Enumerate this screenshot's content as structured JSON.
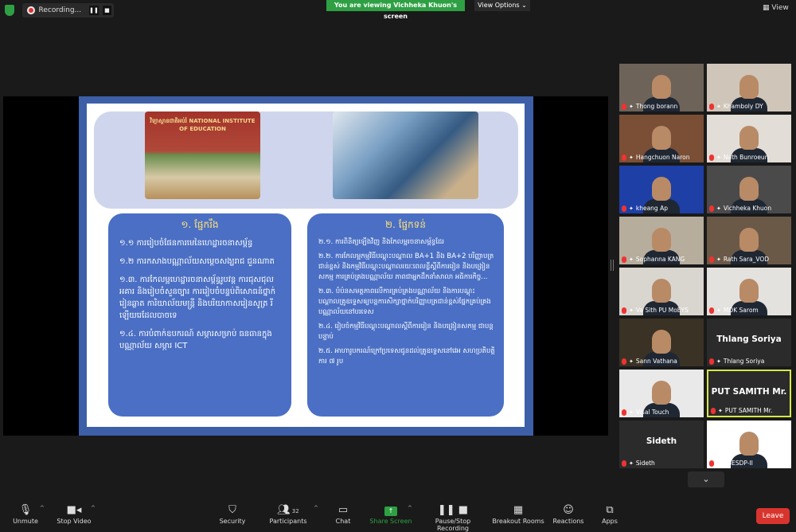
{
  "topbar": {
    "recording_label": "Recording...",
    "pause_glyph": "❚❚",
    "stop_glyph": "■",
    "viewing_banner": "You are viewing Vichheka Khuon's screen",
    "view_options_label": "View Options ⌄",
    "view_label": "View",
    "accent": "#2ea043"
  },
  "slide": {
    "photo1_caption": "វិទ្យាស្ថានជាតិអប់រំ NATIONAL INSTITUTE OF EDUCATION",
    "left_panel": {
      "title": "១. ផ្នែករឹង",
      "items": [
        "១.១ ការរៀបចំផែនការមេនៃហេដ្ឋារចនាសម្ព័ន្ធ",
        "១.២ ការកសាងបណ្ណាល័យសម្ដេចសង្ឃរាជ ជួនណាត",
        "១.៣. ការកែលម្អហេដ្ឋារចនាសម្ព័ន្ធរូបវន្ត ការជុសជុលអគារ និងរៀបចំសួនច្បារ ការរៀបចំបន្ទប់ពិសោធន៍ថ្នាក់រៀនឆ្លាត ការិយាល័យមន្ត្រី និងបរិយាកាសរៀនសូត្រ រីឡើយរេដែលបាចទេ",
        "១.៤. ការបំពាក់ឧបករណ៍ សម្ភារសម្រាប់ ធនធានក្នុងបណ្ណាល័យ សម្ភារ ICT"
      ]
    },
    "right_panel": {
      "title": "២. ផ្នែកទន់",
      "items": [
        "២.១. ការពិនិត្យឡើងវិញ និងកែលម្អរចនាសម្ព័ន្ធដែរ",
        "២.២. ការកែលម្អកម្មវិធីបណ្ដុះបណ្ដាល BA+1 និង BA+2 បរិញ្ញាបត្រជាន់ខ្ពស់ និងកម្មវិធីបណ្ដុះបណ្ដាលរយៈពេលខ្លីស្ដីពីការរៀន និងបង្រៀនសកម្ម ការគ្រប់គ្រងបណ្ណាល័យ ភាពជាអ្នកដឹកនាំសាលា អធិការកិច្ច...",
        "២.៣. បំប៉នសមត្ថភាពលើការគ្រប់គ្រងបណ្ណាល័យ និងការបណ្ដុះបណ្ដាលគ្រូឧទ្ទេសឲ្យបន្តការសិក្សាថ្នាក់បរិញ្ញាបត្រជាន់ខ្ពស់ផ្នែកគ្រប់គ្រងបណ្ណាល័យនៅបរទេស",
        "២.៤. រៀបចំកម្មវិធីបណ្ដុះបណ្ដាលស្ដីពីការរៀន និងបង្រៀនសកម្ម ជាបន្តបន្ទាប់",
        "២.៥. អាហារូបករណ៍ក្រៅប្រទេសជូនដល់គ្រូឧទ្ទេសនៅវេអ សហប្រតិបត្តិការ ៧ រូប"
      ]
    },
    "colors": {
      "frame": "#3d5fa8",
      "panel": "#4a6fc4",
      "title": "#ffe27a"
    }
  },
  "participants": [
    {
      "name": "Thong borann",
      "video": true,
      "bg": "#6d6358"
    },
    {
      "name": "Khamboly DY",
      "video": true,
      "bg": "#cfc6b9"
    },
    {
      "name": "Hangchuon Naron",
      "video": true,
      "bg": "#7a4f36"
    },
    {
      "name": "Nath Bunroeun",
      "video": true,
      "bg": "#e2ddd6"
    },
    {
      "name": "kheang Ap",
      "video": true,
      "bg": "#1e3fa6"
    },
    {
      "name": "Vichheka Khuon",
      "video": true,
      "bg": "#4a4a4a"
    },
    {
      "name": "Sophanna KANG",
      "video": true,
      "bg": "#b6ad9d"
    },
    {
      "name": "Rath Sara_VOD",
      "video": true,
      "bg": "#6b5948"
    },
    {
      "name": "Va Sith PU MoEYS",
      "video": true,
      "bg": "#d9d6cf"
    },
    {
      "name": "MOK Sarom",
      "video": true,
      "bg": "#e4e2de"
    },
    {
      "name": "Sann Vathana",
      "video": true,
      "bg": "#3a3224"
    },
    {
      "name": "Thlang Soriya",
      "video": false,
      "display": "Thlang Soriya"
    },
    {
      "name": "Visal Touch",
      "video": true,
      "bg": "#e9e9e9"
    },
    {
      "name": "PUT SAMITH Mr.",
      "video": false,
      "display": "PUT SAMITH Mr.",
      "active": true
    },
    {
      "name": "Sideth",
      "video": false,
      "display": "Sideth"
    },
    {
      "name": "USESDP-II",
      "video": true,
      "bg": "#ffffff"
    }
  ],
  "gallery_more_glyph": "⌄",
  "toolbar": {
    "unmute": "Unmute",
    "stop_video": "Stop Video",
    "security": "Security",
    "participants": "Participants",
    "participants_count": "32",
    "chat": "Chat",
    "share_screen": "Share Screen",
    "pause_recording": "Pause/Stop Recording",
    "breakout_rooms": "Breakout Rooms",
    "reactions": "Reactions",
    "apps": "Apps",
    "leave": "Leave"
  }
}
